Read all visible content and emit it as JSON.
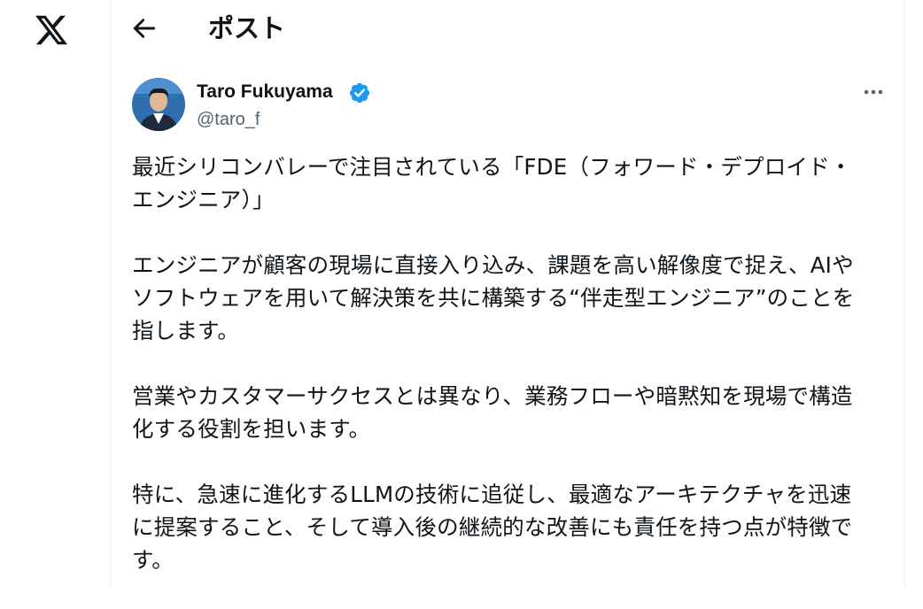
{
  "header": {
    "title": "ポスト"
  },
  "author": {
    "display_name": "Taro Fukuyama",
    "handle": "@taro_f"
  },
  "post": {
    "paragraphs": [
      "最近シリコンバレーで注目されている「FDE（フォワード・デプロイド・\nエンジニア）」",
      "エンジニアが顧客の現場に直接入り込み、課題を高い解像度で捉え、AIや\nソフトウェアを用いて解決策を共に構築する“伴走型エンジニア”のことを\n指します。",
      "営業やカスタマーサクセスとは異なり、業務フローや暗黙知を現場で構造\n化する役割を担います。",
      "特に、急速に進化するLLMの技術に追従し、最適なアーキテクチャを迅速\nに提案すること、そして導入後の継続的な改善にも責任を持つ点が特徴で\nす。"
    ]
  },
  "colors": {
    "text": "#0f1419",
    "secondary": "#536471",
    "verified": "#1d9bf0",
    "border": "#eff3f4"
  },
  "icons": [
    "x-logo-icon",
    "back-arrow-icon",
    "verified-badge-icon",
    "more-options-icon"
  ]
}
